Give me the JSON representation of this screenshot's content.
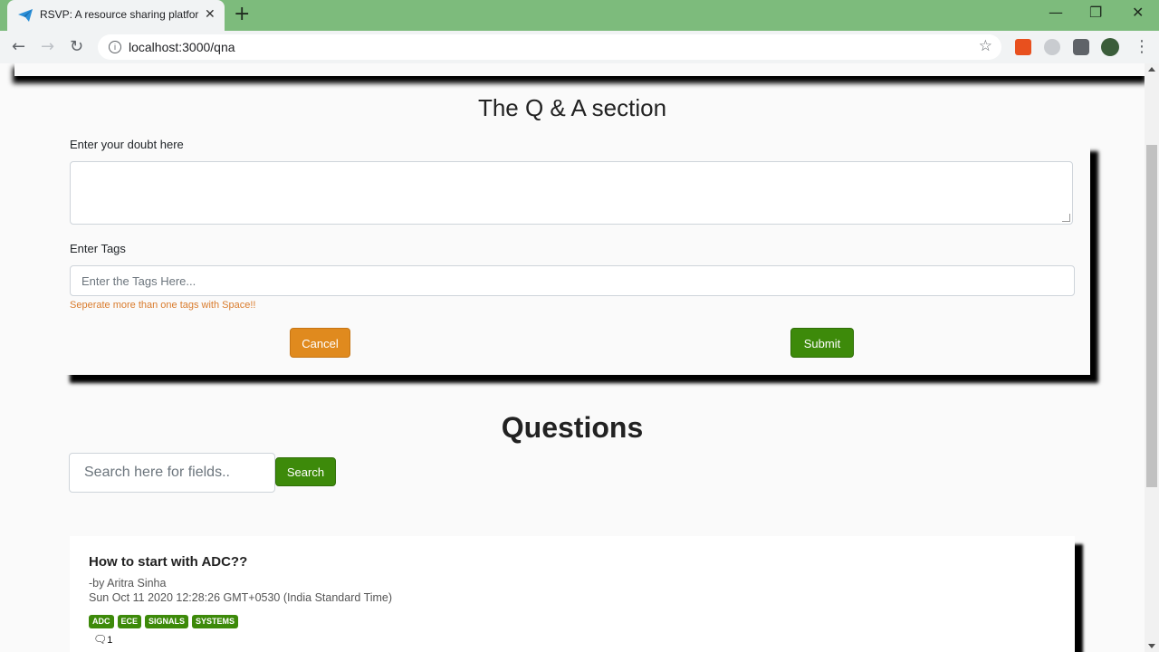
{
  "browser": {
    "tab_title": "RSVP: A resource sharing platfor",
    "url": "localhost:3000/qna",
    "new_tab": "+",
    "tab_close": "✕"
  },
  "qa": {
    "title": "The Q & A section",
    "doubt_label": "Enter your doubt here",
    "doubt_value": "",
    "tags_label": "Enter Tags",
    "tags_placeholder": "Enter the Tags Here...",
    "tags_hint": "Seperate more than one tags with Space!!",
    "cancel": "Cancel",
    "submit": "Submit"
  },
  "questions": {
    "heading": "Questions",
    "search_placeholder": "Search here for fields..",
    "search_button": "Search",
    "items": [
      {
        "title": "How to start with ADC??",
        "author": "-by Aritra Sinha",
        "date": "Sun Oct 11 2020 12:28:26 GMT+0530 (India Standard Time)",
        "tags": [
          "ADC",
          "ECE",
          "SIGNALS",
          "SYSTEMS"
        ],
        "comment_count": "1"
      }
    ]
  },
  "colors": {
    "tabstrip": "#7dbb7c",
    "accent_green": "#3d8a0a",
    "accent_orange": "#e08a1e",
    "hint_orange": "#d97b2c"
  }
}
